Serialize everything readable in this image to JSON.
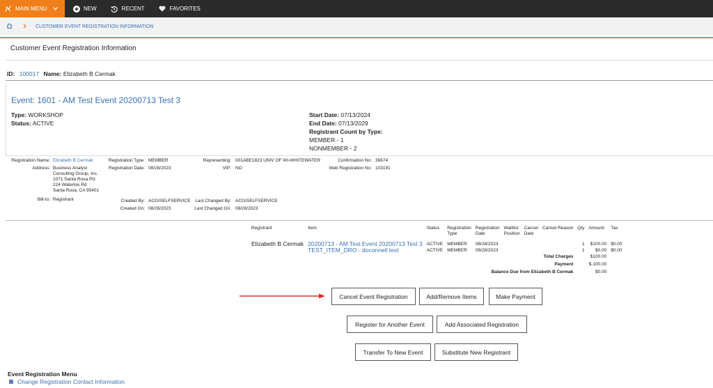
{
  "topbar": {
    "main_menu": "MAIN MENU",
    "new": "NEW",
    "recent": "RECENT",
    "favorites": "FAVORITES"
  },
  "breadcrumb": {
    "current": "CUSTOMER EVENT REGISTRATION INFORMATION"
  },
  "page": {
    "title": "Customer Event Registration Information"
  },
  "customer": {
    "id_label": "ID:",
    "id_value": "100017",
    "name_label": "Name:",
    "name_value": "Elizabeth B Cermak"
  },
  "event": {
    "title": "Event: 1601 - AM Test Event 20200713 Test 3",
    "type_label": "Type:",
    "type_value": "WORKSHOP",
    "status_label": "Status:",
    "status_value": "ACTIVE",
    "start_label": "Start Date:",
    "start_value": "07/13/2024",
    "end_label": "End Date:",
    "end_value": "07/13/2029",
    "count_label": "Registrant Count by Type:",
    "count_member": "MEMBER - 1",
    "count_nonmember": "NONMEMBER - 2"
  },
  "registration": {
    "name_label": "Registration Name:",
    "name_value": "Elizabeth B Cermak",
    "address_label": "Address:",
    "address_lines": [
      "Business Analyst",
      "Consulting Group, Inc.",
      "1071 Santa Rosa Plz",
      "224 Waterloo Rd",
      "Santa Rosa, CA 95401"
    ],
    "billto_label": "Bill-to:",
    "billto_value": "Registrant",
    "type_label": "Registration Type:",
    "type_value": "MEMBER",
    "date_label": "Registration Date:",
    "date_value": "08/28/2023",
    "representing_label": "Representing:",
    "representing_value": "001ABE1823 UNIV OF WI-WHITEWATER",
    "vip_label": "VIP:",
    "vip_value": "NO",
    "confirmation_label": "Confirmation No:",
    "confirmation_value": "36674",
    "web_label": "Web Registration No:",
    "web_value": "103191",
    "created_by_label": "Created By:",
    "created_by_value": "ACGISELFSERVICE",
    "created_on_label": "Created On:",
    "created_on_value": "08/28/2023",
    "changed_by_label": "Last Changed By:",
    "changed_by_value": "ACGISELFSERVICE",
    "changed_on_label": "Last Changed On:",
    "changed_on_value": "08/28/2023"
  },
  "items_table": {
    "headers": {
      "registrant": "Registrant",
      "item": "Item",
      "status": "Status",
      "reg_type_1": "Registration",
      "reg_type_2": "Type",
      "reg_date_1": "Registration",
      "reg_date_2": "Date",
      "waitlist_1": "Waitlist",
      "waitlist_2": "Position",
      "cancel_1": "Cancel",
      "cancel_2": "Date",
      "cancel_reason": "Cancel Reason",
      "qty": "Qty",
      "amount": "Amount",
      "tax": "Tax"
    },
    "registrant": "Elizabeth B Cermak",
    "rows": [
      {
        "item": "20200713 - AM Test Event 20200713 Test 3",
        "status": "ACTIVE",
        "type": "MEMBER",
        "date": "08/28/2023",
        "qty": "1",
        "amount": "$100.00",
        "tax": "$0.00"
      },
      {
        "item": "TEST_ITEM_DRO - doconnell test",
        "status": "ACTIVE",
        "type": "MEMBER",
        "date": "08/28/2023",
        "qty": "1",
        "amount": "$0.00",
        "tax": "$0.00"
      }
    ],
    "total_charges_label": "Total Charges",
    "total_charges_value": "$100.00",
    "payment_label": "Payment",
    "payment_value": "$-100.00",
    "balance_label": "Balance Due from Elizabeth B Cermak",
    "balance_value": "$0.00"
  },
  "buttons": {
    "cancel_registration": "Cancel Event Registration",
    "add_remove_items": "Add/Remove Items",
    "make_payment": "Make Payment",
    "register_another": "Register for Another Event",
    "add_associated": "Add Associated Registration",
    "transfer": "Transfer To New Event",
    "substitute": "Substitute New Registrant"
  },
  "menu": {
    "title": "Event Registration Menu",
    "items": [
      "Change Registration Contact Information"
    ]
  },
  "colors": {
    "accent": "#ef7f1a",
    "topbar": "#2b2b2b",
    "link": "#3a6fb5",
    "arrow": "#d9312b"
  }
}
